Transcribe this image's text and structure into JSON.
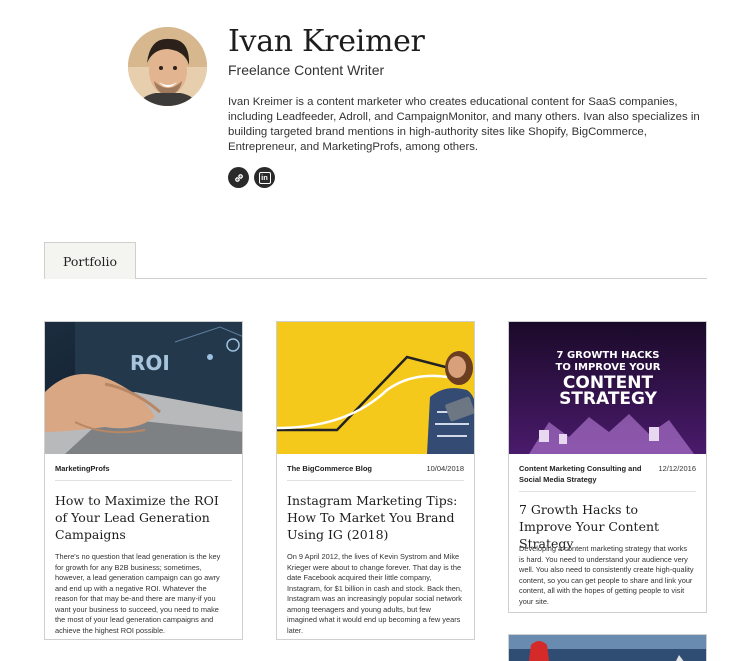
{
  "profile": {
    "name": "Ivan Kreimer",
    "subtitle": "Freelance Content Writer",
    "bio": "Ivan Kreimer is a content marketer who creates educational content for SaaS companies, including Leadfeeder, Adroll, and CampaignMonitor, and many others. Ivan also specializes in building targeted brand mentions in high-authority sites like Shopify, BigCommerce, Entrepreneur, and MarketingProfs, among others.",
    "social": [
      {
        "icon": "link-icon"
      },
      {
        "icon": "linkedin-icon",
        "label": "in"
      }
    ]
  },
  "tabs": [
    {
      "label": "Portfolio",
      "active": true
    }
  ],
  "cards": [
    {
      "source": "MarketingProfs",
      "date": "",
      "title": "How to Maximize the ROI of Your Lead Generation Campaigns",
      "excerpt": "There's no question that lead generation is the key for growth for any B2B business; sometimes, however, a lead generation campaign can go awry and end up with a negative ROI. Whatever the reason for that may be-and there are many-if you want your business to succeed, you need to make the most of your lead generation campaigns and achieve the highest ROI possible.",
      "image_text": "ROI"
    },
    {
      "source": "The BigCommerce Blog",
      "date": "10/04/2018",
      "title": "Instagram Marketing Tips: How To Market You Brand Using IG (2018)",
      "excerpt": "On 9 April 2012, the lives of Kevin Systrom and Mike Krieger were about to change forever. That day is the date Facebook acquired their little company, Instagram, for $1 billion in cash and stock. Back then, Instagram was an increasingly popular social network among teenagers and young adults, but few imagined what it would end up becoming a few years later."
    },
    {
      "source": "Content Marketing Consulting and Social Media Strategy",
      "date": "12/12/2016",
      "title": "7 Growth Hacks to Improve Your Content Strategy",
      "excerpt": "Developing a content marketing strategy that works is hard. You need to understand your audience very well. You also need to consistently create high-quality content, so you can get people to share and link your content, all with the hopes of getting people to visit your site.",
      "image_lines": [
        "7 GROWTH HACKS",
        "TO IMPROVE YOUR",
        "CONTENT",
        "STRATEGY"
      ]
    }
  ]
}
